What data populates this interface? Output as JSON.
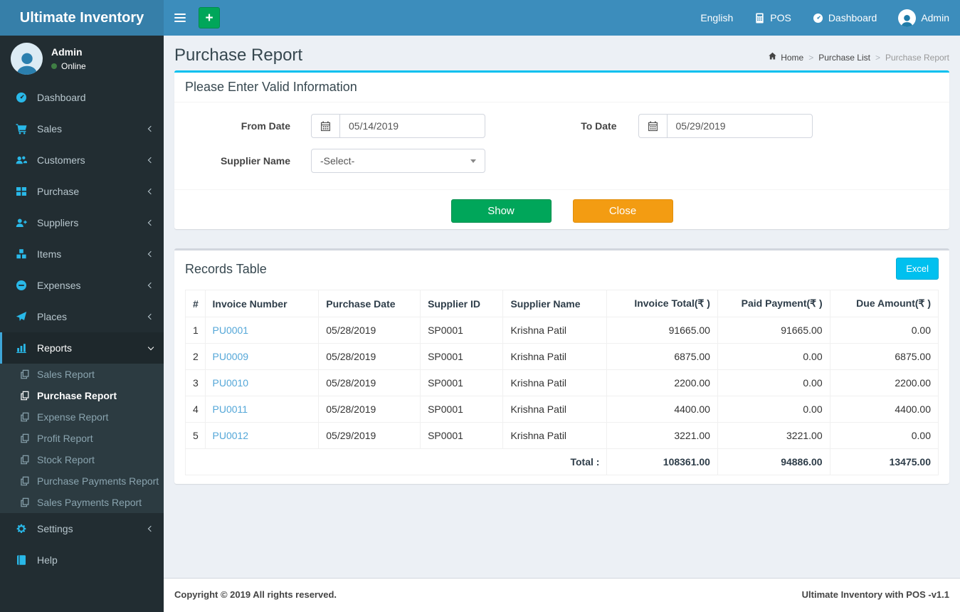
{
  "brand": "Ultimate Inventory",
  "navbar": {
    "language": "English",
    "pos": "POS",
    "dashboard": "Dashboard",
    "user": "Admin"
  },
  "sidebar": {
    "user_name": "Admin",
    "user_status": "Online",
    "items": [
      "Dashboard",
      "Sales",
      "Customers",
      "Purchase",
      "Suppliers",
      "Items",
      "Expenses",
      "Places",
      "Reports",
      "Settings",
      "Help"
    ],
    "reports_sub": [
      "Sales Report",
      "Purchase Report",
      "Expense Report",
      "Profit Report",
      "Stock Report",
      "Purchase Payments Report",
      "Sales Payments Report"
    ]
  },
  "page": {
    "title": "Purchase Report",
    "breadcrumb": {
      "home": "Home",
      "middle": "Purchase List",
      "current": "Purchase Report",
      "sep": ">"
    }
  },
  "filter": {
    "title": "Please Enter Valid Information",
    "from_date_label": "From Date",
    "from_date_value": "05/14/2019",
    "to_date_label": "To Date",
    "to_date_value": "05/29/2019",
    "supplier_label": "Supplier Name",
    "supplier_value": "-Select-",
    "show_label": "Show",
    "close_label": "Close"
  },
  "records": {
    "title": "Records Table",
    "excel_label": "Excel",
    "columns": [
      "#",
      "Invoice Number",
      "Purchase Date",
      "Supplier ID",
      "Supplier Name",
      "Invoice Total(₹ )",
      "Paid Payment(₹ )",
      "Due Amount(₹ )"
    ],
    "rows": [
      {
        "num": "1",
        "invoice": "PU0001",
        "date": "05/28/2019",
        "supplier_id": "SP0001",
        "supplier_name": "Krishna Patil",
        "invoice_total": "91665.00",
        "paid_payment": "91665.00",
        "due_amount": "0.00"
      },
      {
        "num": "2",
        "invoice": "PU0009",
        "date": "05/28/2019",
        "supplier_id": "SP0001",
        "supplier_name": "Krishna Patil",
        "invoice_total": "6875.00",
        "paid_payment": "0.00",
        "due_amount": "6875.00"
      },
      {
        "num": "3",
        "invoice": "PU0010",
        "date": "05/28/2019",
        "supplier_id": "SP0001",
        "supplier_name": "Krishna Patil",
        "invoice_total": "2200.00",
        "paid_payment": "0.00",
        "due_amount": "2200.00"
      },
      {
        "num": "4",
        "invoice": "PU0011",
        "date": "05/28/2019",
        "supplier_id": "SP0001",
        "supplier_name": "Krishna Patil",
        "invoice_total": "4400.00",
        "paid_payment": "0.00",
        "due_amount": "4400.00"
      },
      {
        "num": "5",
        "invoice": "PU0012",
        "date": "05/29/2019",
        "supplier_id": "SP0001",
        "supplier_name": "Krishna Patil",
        "invoice_total": "3221.00",
        "paid_payment": "3221.00",
        "due_amount": "0.00"
      }
    ],
    "total_label": "Total :",
    "totals": {
      "invoice_total": "108361.00",
      "paid_payment": "94886.00",
      "due_amount": "13475.00"
    }
  },
  "footer": {
    "left": "Copyright © 2019 All rights reserved.",
    "right": "Ultimate Inventory with POS -v1.1"
  },
  "colors": {
    "navbar": "#3c8dbc",
    "logo": "#367fa9",
    "sidebar": "#222d32",
    "info": "#00c0ef",
    "success": "#00a65a",
    "warning": "#f39c12",
    "icon_cyan": "#29b8e8"
  }
}
